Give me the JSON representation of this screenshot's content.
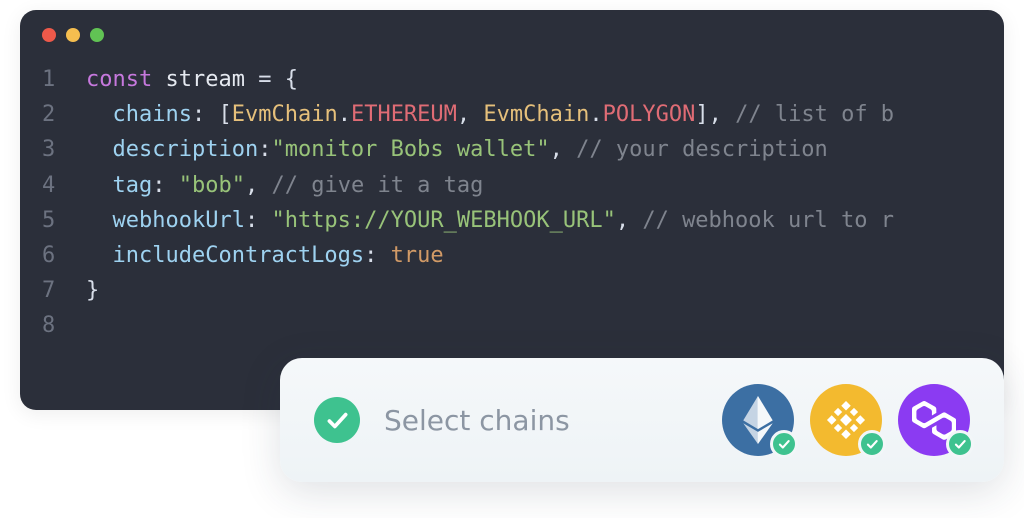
{
  "code": {
    "lines": [
      {
        "n": "1",
        "tokens": [
          {
            "cls": "tok-key",
            "t": "const"
          },
          {
            "cls": "tok-punct",
            "t": " "
          },
          {
            "cls": "tok-ident",
            "t": "stream"
          },
          {
            "cls": "tok-punct",
            "t": " "
          },
          {
            "cls": "tok-punct",
            "t": "="
          },
          {
            "cls": "tok-punct",
            "t": " "
          },
          {
            "cls": "tok-punct",
            "t": "{"
          }
        ]
      },
      {
        "n": "2",
        "tokens": [
          {
            "cls": "tok-punct",
            "t": "  "
          },
          {
            "cls": "tok-prop",
            "t": "chains"
          },
          {
            "cls": "tok-punct",
            "t": ": ["
          },
          {
            "cls": "tok-class",
            "t": "EvmChain"
          },
          {
            "cls": "tok-punct",
            "t": "."
          },
          {
            "cls": "tok-const",
            "t": "ETHEREUM"
          },
          {
            "cls": "tok-punct",
            "t": ", "
          },
          {
            "cls": "tok-class",
            "t": "EvmChain"
          },
          {
            "cls": "tok-punct",
            "t": "."
          },
          {
            "cls": "tok-const",
            "t": "POLYGON"
          },
          {
            "cls": "tok-punct",
            "t": "], "
          },
          {
            "cls": "tok-comm",
            "t": "// list of b"
          }
        ]
      },
      {
        "n": "3",
        "tokens": [
          {
            "cls": "tok-punct",
            "t": "  "
          },
          {
            "cls": "tok-prop",
            "t": "description"
          },
          {
            "cls": "tok-punct",
            "t": ":"
          },
          {
            "cls": "tok-str",
            "t": "\"monitor Bobs wallet\""
          },
          {
            "cls": "tok-punct",
            "t": ", "
          },
          {
            "cls": "tok-comm",
            "t": "// your description"
          }
        ]
      },
      {
        "n": "4",
        "tokens": [
          {
            "cls": "tok-punct",
            "t": "  "
          },
          {
            "cls": "tok-prop",
            "t": "tag"
          },
          {
            "cls": "tok-punct",
            "t": ": "
          },
          {
            "cls": "tok-str",
            "t": "\"bob\""
          },
          {
            "cls": "tok-punct",
            "t": ", "
          },
          {
            "cls": "tok-comm",
            "t": "// give it a tag"
          }
        ]
      },
      {
        "n": "5",
        "tokens": [
          {
            "cls": "tok-punct",
            "t": "  "
          },
          {
            "cls": "tok-prop",
            "t": "webhookUrl"
          },
          {
            "cls": "tok-punct",
            "t": ": "
          },
          {
            "cls": "tok-str",
            "t": "\"https://YOUR_WEBHOOK_URL\""
          },
          {
            "cls": "tok-punct",
            "t": ", "
          },
          {
            "cls": "tok-comm",
            "t": "// webhook url to r"
          }
        ]
      },
      {
        "n": "6",
        "tokens": [
          {
            "cls": "tok-punct",
            "t": "  "
          },
          {
            "cls": "tok-prop",
            "t": "includeContractLogs"
          },
          {
            "cls": "tok-punct",
            "t": ": "
          },
          {
            "cls": "tok-bool",
            "t": "true"
          }
        ]
      },
      {
        "n": "7",
        "tokens": [
          {
            "cls": "tok-punct",
            "t": "}"
          }
        ]
      },
      {
        "n": "8",
        "tokens": []
      }
    ]
  },
  "panel": {
    "label": "Select chains",
    "chains": [
      "ethereum",
      "bnb",
      "polygon"
    ]
  },
  "colors": {
    "editor_bg": "#2b2f3a",
    "accent_green": "#3ec28f",
    "eth": "#3c6fa3",
    "bnb": "#f3ba2f",
    "polygon": "#8b3bf2"
  }
}
